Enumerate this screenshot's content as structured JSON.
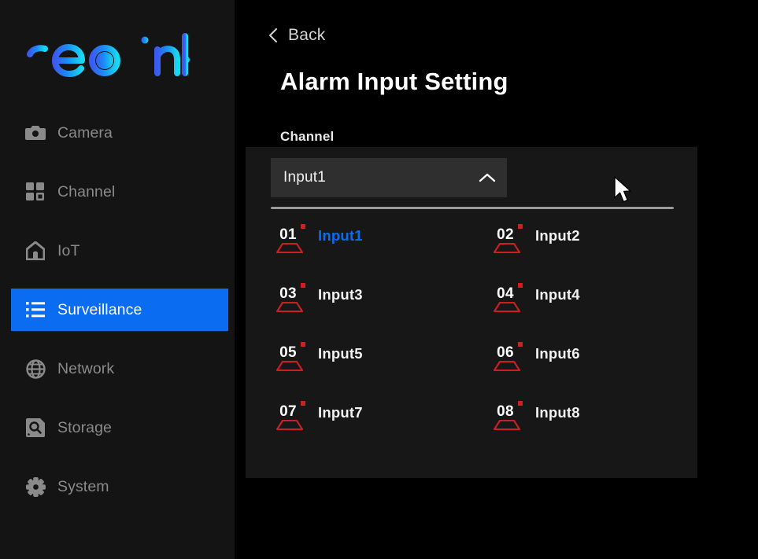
{
  "brand": {
    "logo_text": "reolink",
    "logo_color_start": "#3b5bf0",
    "logo_color_end": "#18d8f0"
  },
  "sidebar": {
    "items": [
      {
        "label": "Camera",
        "icon": "camera-icon",
        "active": false
      },
      {
        "label": "Channel",
        "icon": "grid-icon",
        "active": false
      },
      {
        "label": "IoT",
        "icon": "home-icon",
        "active": false
      },
      {
        "label": "Surveillance",
        "icon": "list-icon",
        "active": true
      },
      {
        "label": "Network",
        "icon": "globe-icon",
        "active": false
      },
      {
        "label": "Storage",
        "icon": "storage-disk-icon",
        "active": false
      },
      {
        "label": "System",
        "icon": "gear-icon",
        "active": false
      }
    ],
    "active_color": "#0a6cf0",
    "inactive_color": "#8a8a8a"
  },
  "header": {
    "back_label": "Back",
    "back_icon": "chevron-left-icon",
    "title": "Alarm Input Setting"
  },
  "form": {
    "channel_label": "Channel"
  },
  "dropdown": {
    "selected_value": "Input1",
    "chevron_icon": "chevron-up-icon",
    "expanded": true,
    "options": [
      {
        "number": "01",
        "label": "Input1",
        "selected": true
      },
      {
        "number": "02",
        "label": "Input2",
        "selected": false
      },
      {
        "number": "03",
        "label": "Input3",
        "selected": false
      },
      {
        "number": "04",
        "label": "Input4",
        "selected": false
      },
      {
        "number": "05",
        "label": "Input5",
        "selected": false
      },
      {
        "number": "06",
        "label": "Input6",
        "selected": false
      },
      {
        "number": "07",
        "label": "Input7",
        "selected": false
      },
      {
        "number": "08",
        "label": "Input8",
        "selected": false
      }
    ],
    "option_icon": "alarm-input-sensor-icon",
    "option_icon_color": "#cc1f1f",
    "selected_label_color": "#0a6cf0"
  },
  "cursor": {
    "icon": "mouse-pointer-arrow"
  }
}
